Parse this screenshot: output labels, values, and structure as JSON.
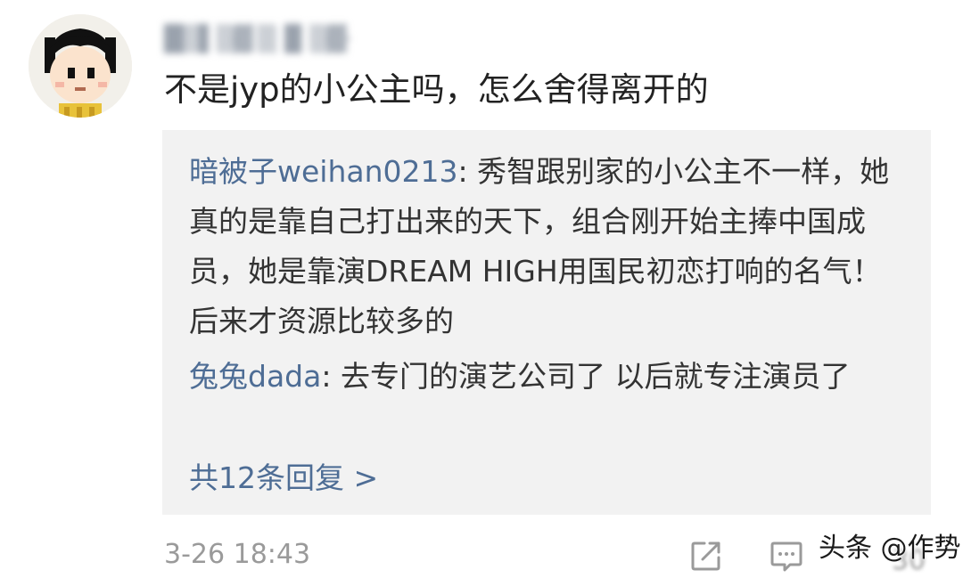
{
  "comment": {
    "username": "█▒▌▒▓ ▒▐▌▒▓·",
    "text": "不是jyp的小公主吗，怎么舍得离开的",
    "timestamp": "3-26 18:43"
  },
  "replies": [
    {
      "name": "暗被子weihan0213",
      "sep": ": ",
      "text": "秀智跟别家的小公主不一样，她真的是靠自己打出来的天下，组合刚开始主捧中国成员，她是靠演DREAM HIGH用国民初恋打响的名气！后来才资源比较多的"
    },
    {
      "name": "兔兔dada",
      "sep": ": ",
      "text": "去专门的演艺公司了 以后就专注演员了"
    }
  ],
  "more_replies": "共12条回复 >",
  "actions": {
    "share_icon": "share-icon",
    "comment_icon": "comment-icon",
    "count": "30"
  },
  "watermark": "头条 @作势",
  "colors": {
    "link": "#4e6d95",
    "reply_bg": "#f2f2f2",
    "text": "#222222",
    "meta": "#9a9a9a"
  }
}
